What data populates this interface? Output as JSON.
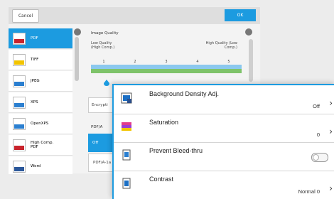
{
  "toolbar": {
    "cancel_label": "Cancel",
    "ok_label": "OK"
  },
  "file_types": [
    {
      "label": "PDF",
      "selected": true,
      "color": "#1c9be0"
    },
    {
      "label": "TIFF",
      "selected": false,
      "color": "#f2c400"
    },
    {
      "label": "JPEG",
      "selected": false,
      "color": "#2b7fd0"
    },
    {
      "label": "XPS",
      "selected": false,
      "color": "#2b7fd0"
    },
    {
      "label": "OpenXPS",
      "selected": false,
      "color": "#2b7fd0"
    },
    {
      "label": "High Comp. PDF",
      "selected": false,
      "color": "#c8232c"
    },
    {
      "label": "Word",
      "selected": false,
      "color": "#2b579a"
    }
  ],
  "image_quality": {
    "title": "Image Quality",
    "low_label": "Low Quality (High Comp.)",
    "high_label": "High Quality (Low Comp.)",
    "scale": [
      "1",
      "2",
      "3",
      "4",
      "5"
    ],
    "selected": 1
  },
  "encryption": {
    "label": "Encrypti"
  },
  "pdfa": {
    "label": "PDF/A",
    "options": [
      "Off",
      "PDF/A-1a"
    ],
    "selected": "Off"
  },
  "popup": {
    "rows": [
      {
        "title": "Background Density Adj.",
        "value": "Off",
        "icon": "background-density-icon",
        "type": "value"
      },
      {
        "title": "Saturation",
        "value": "0",
        "icon": "saturation-icon",
        "type": "value"
      },
      {
        "title": "Prevent Bleed-thru",
        "value": "",
        "icon": "prevent-bleed-icon",
        "type": "toggle",
        "toggle_on": false
      },
      {
        "title": "Contrast",
        "value": "Normal 0",
        "icon": "contrast-icon",
        "type": "value"
      }
    ]
  },
  "colors": {
    "accent": "#1c9be0"
  }
}
